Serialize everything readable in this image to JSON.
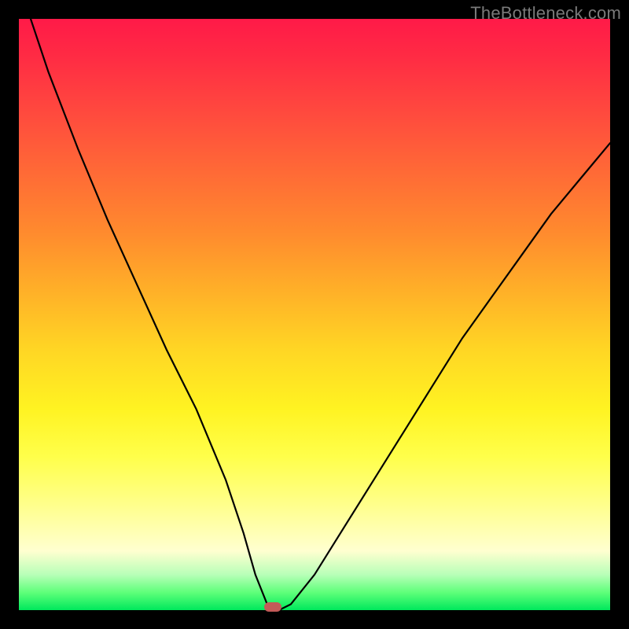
{
  "watermark": "TheBottleneck.com",
  "chart_data": {
    "type": "line",
    "title": "",
    "xlabel": "",
    "ylabel": "",
    "xlim": [
      0,
      100
    ],
    "ylim": [
      0,
      100
    ],
    "series": [
      {
        "name": "bottleneck-curve",
        "x": [
          2,
          5,
          10,
          15,
          20,
          25,
          30,
          35,
          38,
          40,
          42,
          43,
          44,
          46,
          50,
          55,
          60,
          65,
          70,
          75,
          80,
          85,
          90,
          95,
          100
        ],
        "values": [
          100,
          91,
          78,
          66,
          55,
          44,
          34,
          22,
          13,
          6,
          1,
          0,
          0,
          1,
          6,
          14,
          22,
          30,
          38,
          46,
          53,
          60,
          67,
          73,
          79
        ]
      }
    ],
    "marker": {
      "x": 43,
      "y": 0.5,
      "color": "#c35a58"
    },
    "gradient_stops": [
      {
        "pos": 0.0,
        "color": "#ff1a48"
      },
      {
        "pos": 0.5,
        "color": "#ffd624"
      },
      {
        "pos": 0.9,
        "color": "#ffffd0"
      },
      {
        "pos": 1.0,
        "color": "#00e85c"
      }
    ]
  }
}
